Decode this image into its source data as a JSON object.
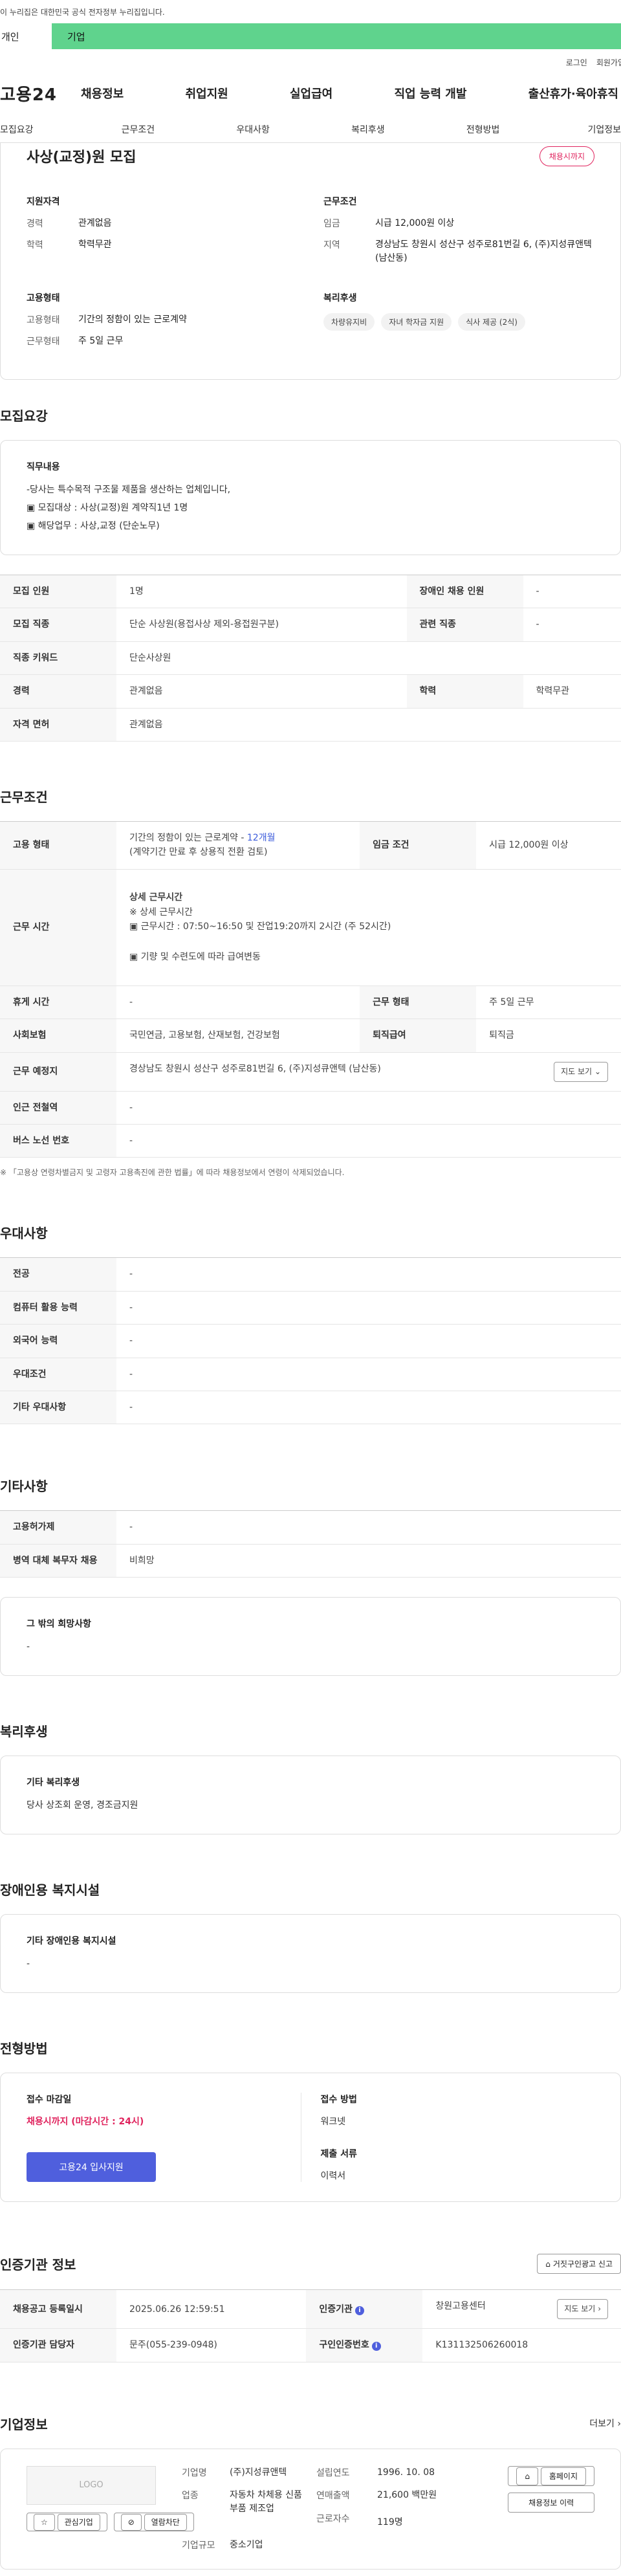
{
  "gov_notice": "이 누리집은 대한민국 공식 전자정부 누리집입니다.",
  "user_tabs": [
    "개인",
    "기업"
  ],
  "util_links": [
    "로그인",
    "회원가입"
  ],
  "logo": "고용24",
  "gnb": [
    "채용정보",
    "취업지원",
    "실업급여",
    "직업 능력 개발",
    "출산휴가·육아휴직"
  ],
  "subtabs": [
    "모집요강",
    "근무조건",
    "우대사항",
    "복리후생",
    "전형방법",
    "기업정보"
  ],
  "summary": {
    "title": "사상(교정)원 모집",
    "badge": "채용시까지",
    "qual_title": "지원자격",
    "qual": [
      {
        "k": "경력",
        "v": "관계없음"
      },
      {
        "k": "학력",
        "v": "학력무관"
      }
    ],
    "work_title": "근무조건",
    "work": [
      {
        "k": "임금",
        "v": "시급 12,000원 이상"
      },
      {
        "k": "지역",
        "v": "경상남도 창원시 성산구 성주로81번길 6, (주)지성큐앤텍 (남산동)"
      }
    ],
    "emp_title": "고용형태",
    "emp": [
      {
        "k": "고용형태",
        "v": "기간의 정함이 있는 근로계약"
      },
      {
        "k": "근무형태",
        "v": "주 5일 근무"
      }
    ],
    "welfare_title": "복리후생",
    "welfare_chips": [
      "차량유지비",
      "자녀 학자금 지원",
      "식사 제공 (2식)"
    ]
  },
  "recruit": {
    "title": "모집요강",
    "duty_title": "직무내용",
    "duty_lines": [
      "-당사는 특수목적 구조물 제품을 생산하는 업체입니다,",
      "▣ 모집대상 : 사상(교정)원 계약직1년 1명",
      "▣ 해당업무 : 사상,교정 (단순노무)"
    ],
    "rows": [
      [
        {
          "k": "모집 인원",
          "v": "1명"
        },
        {
          "k": "장애인 채용 인원",
          "v": "-"
        }
      ],
      [
        {
          "k": "모집 직종",
          "v": "단순 사상원(용접사상 제외-용접원구분)"
        },
        {
          "k": "관련 직종",
          "v": "-"
        }
      ],
      [
        {
          "k": "직종 키워드",
          "v": "단순사상원"
        }
      ],
      [
        {
          "k": "경력",
          "v": "관계없음"
        },
        {
          "k": "학력",
          "v": "학력무관"
        }
      ],
      [
        {
          "k": "자격 면허",
          "v": "관계없음"
        }
      ]
    ]
  },
  "work": {
    "title": "근무조건",
    "emp_type_k": "고용 형태",
    "emp_type_v": "기간의 정함이 있는 근로계약 - ",
    "emp_type_months": "12개월",
    "emp_type_note": "(계약기간 만료 후 상용직 전환 검토)",
    "wage_k": "임금 조건",
    "wage_v": "시급 12,000원 이상",
    "hours_k": "근무 시간",
    "hours_lines": [
      "상세 근무시간",
      "※ 상세 근무시간",
      "▣ 근무시간 : 07:50~16:50 및 잔업19:20까지 2시간 (주 52시간)",
      "",
      "▣ 기량 및 수련도에 따라 급여변동"
    ],
    "rows": [
      [
        {
          "k": "휴게 시간",
          "v": "-"
        },
        {
          "k": "근무 형태",
          "v": "주 5일 근무"
        }
      ],
      [
        {
          "k": "사회보험",
          "v": "국민연금, 고용보험, 산재보험, 건강보험"
        },
        {
          "k": "퇴직급여",
          "v": "퇴직금"
        }
      ]
    ],
    "place_k": "근무 예정지",
    "place_v": "경상남도 창원시 성산구 성주로81번길 6, (주)지성큐앤텍 (남산동)",
    "map_btn": "지도 보기",
    "station_k": "인근 전철역",
    "station_v": "-",
    "bus_k": "버스 노선 번호",
    "bus_v": "-",
    "note": "※ 「고용상 연령차별금지 및 고령자 고용촉진에 관한 법률」에 따라 채용정보에서 연령이 삭제되었습니다."
  },
  "pref": {
    "title": "우대사항",
    "rows": [
      {
        "k": "전공",
        "v": "-"
      },
      {
        "k": "컴퓨터 활용 능력",
        "v": "-"
      },
      {
        "k": "외국어 능력",
        "v": "-"
      },
      {
        "k": "우대조건",
        "v": "-"
      },
      {
        "k": "기타 우대사항",
        "v": "-"
      }
    ]
  },
  "etc": {
    "title": "기타사항",
    "rows": [
      {
        "k": "고용허가제",
        "v": "-"
      },
      {
        "k": "병역 대체 복무자 채용",
        "v": "비희망"
      }
    ],
    "box_title": "그 밖의 희망사항",
    "box_v": "-"
  },
  "welfare": {
    "title": "복리후생",
    "box_title": "기타 복리후생",
    "box_v": "당사 상조회 운영, 경조금지원"
  },
  "disability": {
    "title": "장애인용 복지시설",
    "box_title": "기타 장애인용 복지시설",
    "box_v": "-"
  },
  "apply": {
    "title": "전형방법",
    "deadline_lbl": "접수 마감일",
    "deadline_v": "채용시까지 (마감시간 : 24시)",
    "apply_btn": "고용24 입사지원",
    "method_lbl": "접수 방법",
    "method_v": "워크넷",
    "docs_lbl": "제출 서류",
    "docs_v": "이력서"
  },
  "cert": {
    "title": "인증기관 정보",
    "report_btn": "거짓구인광고 신고",
    "reg_k": "채용공고 등록일시",
    "reg_v": "2025.06.26 12:59:51",
    "org_k": "인증기관",
    "org_v": "창원고용센터",
    "map_btn": "지도 보기",
    "staff_k": "인증기관 담당자",
    "staff_v": "문주(055-239-0948)",
    "num_k": "구인인증번호",
    "num_v": "K131132506260018"
  },
  "company": {
    "title": "기업정보",
    "more": "더보기",
    "logo_ph": "LOGO",
    "fav_btn": "관심기업",
    "block_btn": "열람차단",
    "name_k": "기업명",
    "name_v": "(주)지성큐앤텍",
    "year_k": "설립연도",
    "year_v": "1996. 10. 08",
    "ind_k": "업종",
    "ind_v": "자동차 차체용 신품 부품 제조업",
    "sales_k": "연매출액",
    "sales_v": "21,600 백만원",
    "emp_k": "근로자수",
    "emp_v": "119명",
    "size_k": "기업규모",
    "size_v": "중소기업",
    "home_btn": "홈페이지",
    "history_btn": "채용정보 이력"
  }
}
